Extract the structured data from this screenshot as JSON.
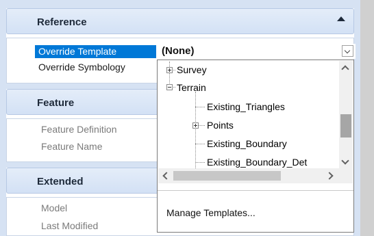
{
  "groups": {
    "reference": {
      "title": "Reference",
      "rows": [
        {
          "label": "Override Template",
          "value": "(None)"
        },
        {
          "label": "Override Symbology"
        }
      ]
    },
    "feature": {
      "title": "Feature",
      "rows": [
        {
          "label": "Feature Definition"
        },
        {
          "label": "Feature Name"
        }
      ]
    },
    "extended": {
      "title": "Extended",
      "rows": [
        {
          "label": "Model"
        },
        {
          "label": "Last Modified"
        }
      ]
    }
  },
  "dropdown": {
    "tree": [
      {
        "label": "Survey"
      },
      {
        "label": "Terrain"
      },
      {
        "label": "Existing_Triangles"
      },
      {
        "label": "Points"
      },
      {
        "label": "Existing_Boundary"
      },
      {
        "label": "Existing_Boundary_Det"
      }
    ],
    "footer": "Manage Templates..."
  },
  "icons": {
    "collapse": "chevron-up-icon",
    "combo": "chevron-down-icon",
    "expand": "plus-box-icon",
    "collapse_node": "minus-box-icon"
  },
  "colors": {
    "selection": "#0078d7",
    "header_bg": "#d3e1f5"
  }
}
